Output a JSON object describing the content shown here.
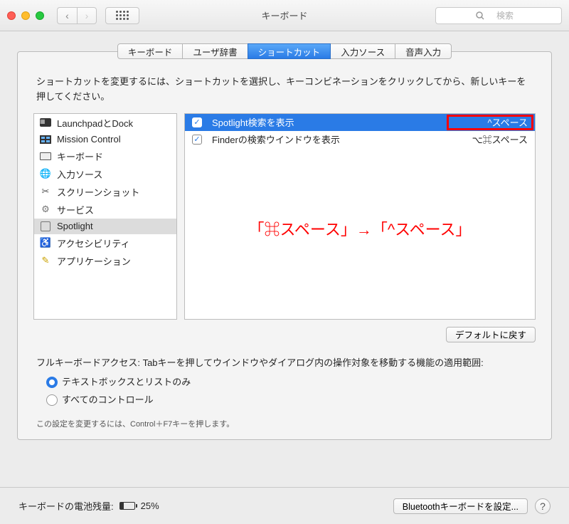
{
  "titlebar": {
    "title": "キーボード",
    "search_placeholder": "検索"
  },
  "tabs": [
    {
      "label": "キーボード",
      "active": false
    },
    {
      "label": "ユーザ辞書",
      "active": false
    },
    {
      "label": "ショートカット",
      "active": true
    },
    {
      "label": "入力ソース",
      "active": false
    },
    {
      "label": "音声入力",
      "active": false
    }
  ],
  "description": "ショートカットを変更するには、ショートカットを選択し、キーコンビネーションをクリックしてから、新しいキーを押してください。",
  "categories": [
    {
      "label": "LaunchpadとDock",
      "icon": "launchpad"
    },
    {
      "label": "Mission Control",
      "icon": "mission"
    },
    {
      "label": "キーボード",
      "icon": "keyboard"
    },
    {
      "label": "入力ソース",
      "icon": "input"
    },
    {
      "label": "スクリーンショット",
      "icon": "screenshot"
    },
    {
      "label": "サービス",
      "icon": "service"
    },
    {
      "label": "Spotlight",
      "icon": "spotlight",
      "selected": true
    },
    {
      "label": "アクセシビリティ",
      "icon": "accessibility"
    },
    {
      "label": "アプリケーション",
      "icon": "app"
    }
  ],
  "shortcuts": [
    {
      "checked": true,
      "label": "Spotlight検索を表示",
      "keys": "^スペース",
      "selected": true,
      "highlighted": true
    },
    {
      "checked": true,
      "label": "Finderの検索ウインドウを表示",
      "keys": "⌥⌘スペース"
    }
  ],
  "overlay_annotation": "「⌘スペース」→「^スペース」",
  "restore_button": "デフォルトに戻す",
  "kb_access": {
    "label": "フルキーボードアクセス: Tabキーを押してウインドウやダイアログ内の操作対象を移動する機能の適用範囲:",
    "options": [
      {
        "label": "テキストボックスとリストのみ",
        "selected": true
      },
      {
        "label": "すべてのコントロール",
        "selected": false
      }
    ],
    "hint": "この設定を変更するには、Control＋F7キーを押します。"
  },
  "footer": {
    "battery_label": "キーボードの電池残量:",
    "battery_pct": "25%",
    "bluetooth_button": "Bluetoothキーボードを設定..."
  }
}
